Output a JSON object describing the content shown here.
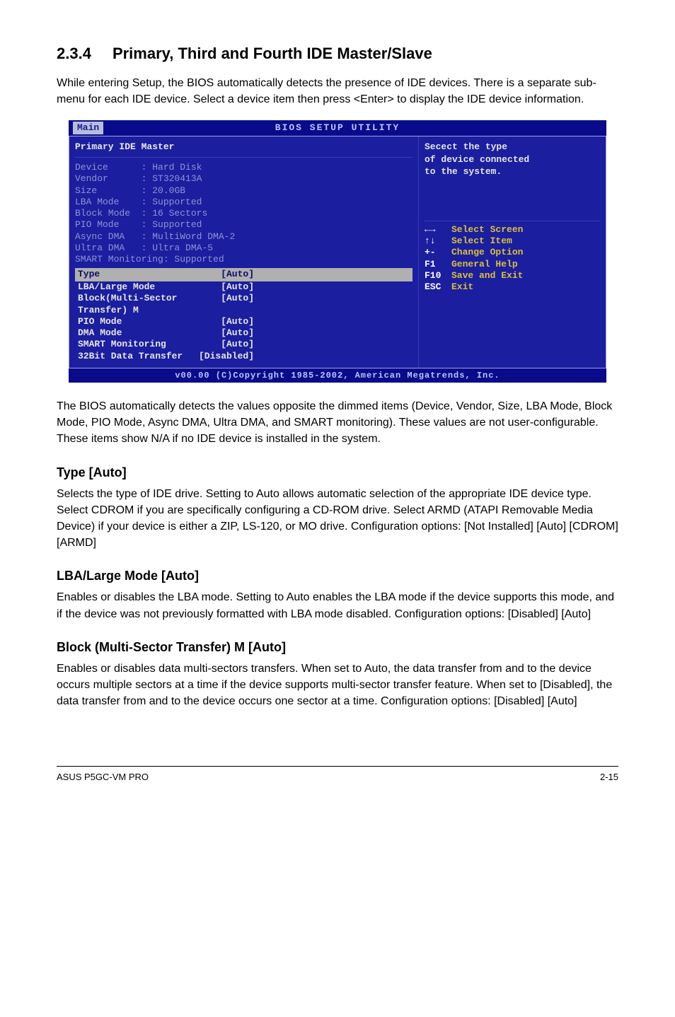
{
  "section": {
    "number": "2.3.4",
    "title": "Primary, Third and Fourth IDE Master/Slave",
    "intro": "While entering Setup, the BIOS automatically detects the presence of IDE devices. There is a separate sub-menu for each IDE device. Select a device item then press <Enter> to display the IDE device information."
  },
  "bios": {
    "topbar": "BIOS SETUP UTILITY",
    "tab": "Main",
    "panel_title": "Primary IDE Master",
    "info": [
      {
        "label": "Device",
        "value": ": Hard Disk"
      },
      {
        "label": "Vendor",
        "value": ": ST320413A"
      },
      {
        "label": "Size",
        "value": ": 20.0GB"
      },
      {
        "label": "LBA Mode",
        "value": ": Supported"
      },
      {
        "label": "Block Mode",
        "value": ": 16 Sectors"
      },
      {
        "label": "PIO Mode",
        "value": ": Supported"
      },
      {
        "label": "Async DMA",
        "value": ": MultiWord DMA-2"
      },
      {
        "label": "Ultra DMA",
        "value": ": Ultra DMA-5"
      },
      {
        "label": "SMART Monitoring: Supported",
        "value": ""
      }
    ],
    "type_row": {
      "label": "Type",
      "value": "[Auto]"
    },
    "options": [
      {
        "label": "LBA/Large Mode",
        "value": "[Auto]"
      },
      {
        "label": "Block(Multi-Sector Transfer) M",
        "value": "[Auto]"
      },
      {
        "label": "PIO Mode",
        "value": "[Auto]"
      },
      {
        "label": "DMA Mode",
        "value": "[Auto]"
      },
      {
        "label": "SMART Monitoring",
        "value": "[Auto]"
      },
      {
        "label": "32Bit Data Transfer",
        "value": "[Disabled]"
      }
    ],
    "help": {
      "line1": "Secect the type",
      "line2": "of device connected",
      "line3": "to the system."
    },
    "nav": [
      {
        "key": "←→",
        "desc": "Select Screen"
      },
      {
        "key": "↑↓",
        "desc": "Select Item"
      },
      {
        "key": "+-",
        "desc": "Change Option"
      },
      {
        "key": "F1",
        "desc": "General Help"
      },
      {
        "key": "F10",
        "desc": "Save and Exit"
      },
      {
        "key": "ESC",
        "desc": "Exit"
      }
    ],
    "footer": "v00.00 (C)Copyright 1985-2002, American Megatrends, Inc."
  },
  "post_bios": "The BIOS automatically detects the values opposite the dimmed items (Device, Vendor, Size, LBA Mode, Block Mode, PIO Mode, Async DMA, Ultra DMA, and SMART monitoring). These values are not user-configurable. These items show N/A if no IDE device is installed in the system.",
  "subs": [
    {
      "title": "Type [Auto]",
      "body": "Selects the type of IDE drive. Setting to Auto allows automatic selection of the appropriate IDE device type. Select CDROM if you are specifically configuring a CD-ROM drive. Select ARMD (ATAPI Removable Media Device) if your device is either a ZIP, LS-120, or MO drive. Configuration options: [Not Installed] [Auto] [CDROM] [ARMD]"
    },
    {
      "title": "LBA/Large Mode [Auto]",
      "body": "Enables or disables the LBA mode. Setting to Auto enables the LBA mode if the device supports this mode, and if the device was not previously formatted with LBA mode disabled. Configuration options: [Disabled] [Auto]"
    },
    {
      "title": "Block (Multi-Sector Transfer) M [Auto]",
      "body": "Enables or disables data multi-sectors transfers. When set to Auto, the data transfer from and to the device occurs multiple sectors at a time if the device supports multi-sector transfer feature. When set to [Disabled], the data transfer from and to the device occurs one sector at a time. Configuration options: [Disabled] [Auto]"
    }
  ],
  "footer": {
    "left": "ASUS P5GC-VM PRO",
    "right": "2-15"
  }
}
